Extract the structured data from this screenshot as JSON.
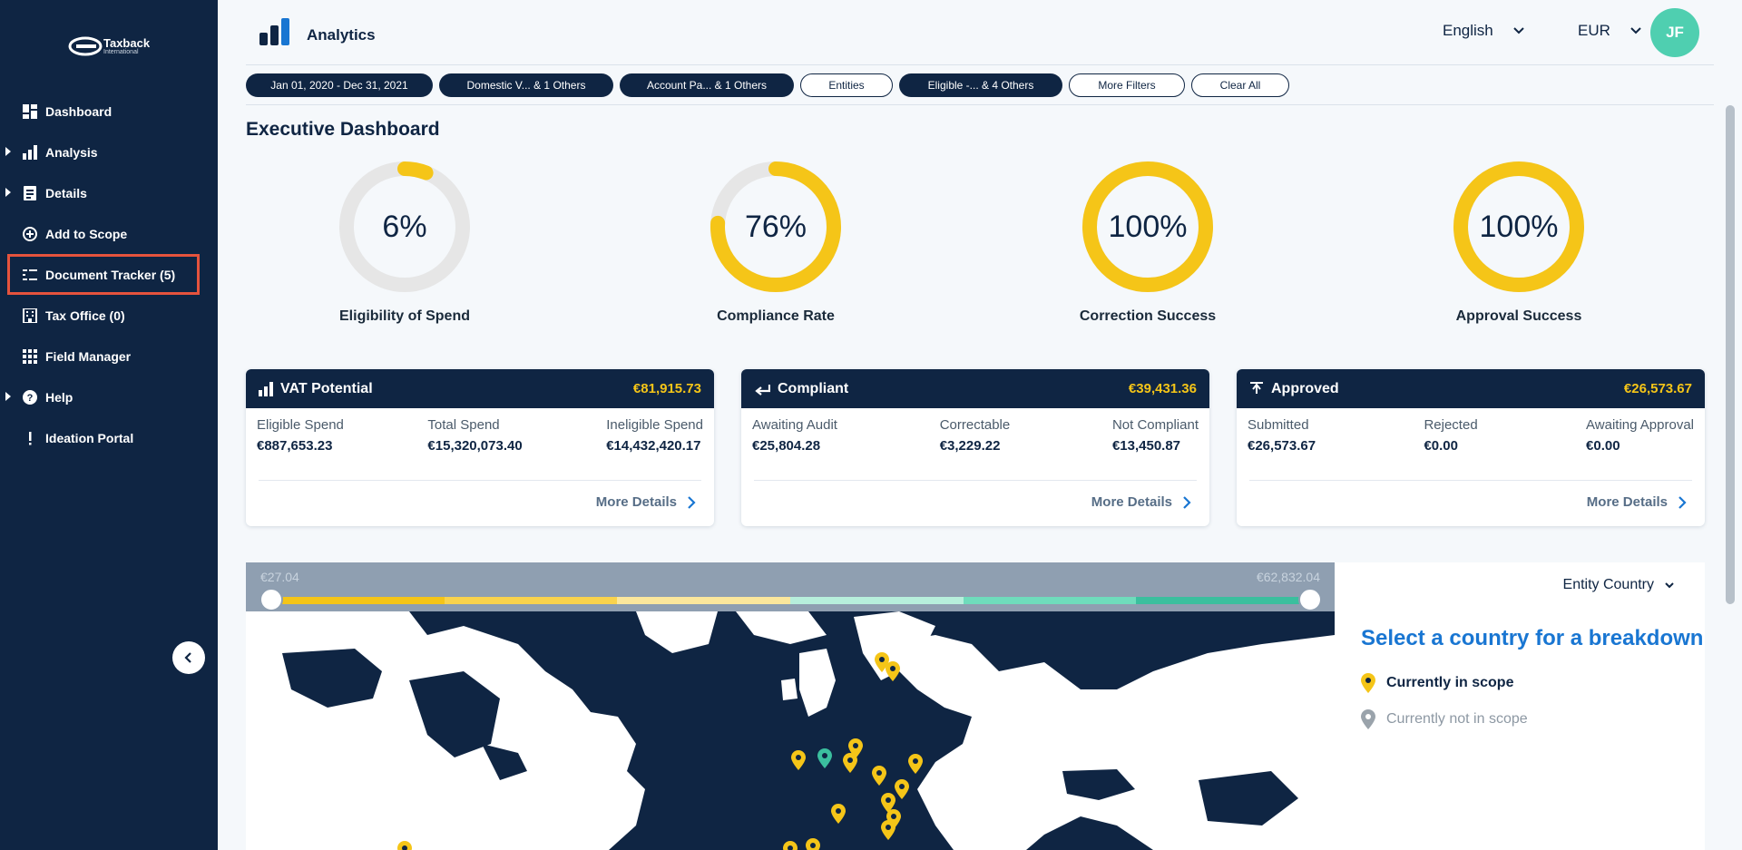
{
  "brand": {
    "name": "Taxback",
    "sub": "International"
  },
  "sidebar": {
    "items": [
      {
        "label": "Dashboard",
        "icon": "dashboard-icon",
        "caret": false
      },
      {
        "label": "Analysis",
        "icon": "bar-chart-icon",
        "caret": true
      },
      {
        "label": "Details",
        "icon": "document-list-icon",
        "caret": true
      },
      {
        "label": "Add to Scope",
        "icon": "plus-circle-icon",
        "caret": false
      },
      {
        "label": "Document Tracker (5)",
        "icon": "tracker-icon",
        "caret": false,
        "highlighted": true
      },
      {
        "label": "Tax Office (0)",
        "icon": "building-icon",
        "caret": false
      },
      {
        "label": "Field Manager",
        "icon": "grid-icon",
        "caret": false
      },
      {
        "label": "Help",
        "icon": "help-icon",
        "caret": true
      },
      {
        "label": "Ideation Portal",
        "icon": "exclamation-icon",
        "caret": false
      }
    ]
  },
  "header": {
    "title": "Analytics",
    "language": "English",
    "currency": "EUR",
    "avatar_initials": "JF"
  },
  "filters": [
    {
      "label": "Jan 01, 2020 - Dec 31, 2021",
      "style": "dark"
    },
    {
      "label": "Domestic V... & 1 Others",
      "style": "dark"
    },
    {
      "label": "Account Pa... & 1 Others",
      "style": "dark"
    },
    {
      "label": "Entities",
      "style": "light"
    },
    {
      "label": "Eligible -... & 4 Others",
      "style": "dark"
    },
    {
      "label": "More Filters",
      "style": "light"
    },
    {
      "label": "Clear All",
      "style": "light"
    }
  ],
  "page_title": "Executive Dashboard",
  "gauges": [
    {
      "value_text": "6%",
      "fraction": 0.06,
      "label": "Eligibility of Spend"
    },
    {
      "value_text": "76%",
      "fraction": 0.76,
      "label": "Compliance Rate"
    },
    {
      "value_text": "100%",
      "fraction": 1.0,
      "label": "Correction Success"
    },
    {
      "value_text": "100%",
      "fraction": 1.0,
      "label": "Approval Success"
    }
  ],
  "cards": [
    {
      "title": "VAT Potential",
      "amount": "€81,915.73",
      "icon": "bar-chart-icon",
      "cols": [
        {
          "label": "Eligible Spend",
          "value": "€887,653.23"
        },
        {
          "label": "Total Spend",
          "value": "€15,320,073.40"
        },
        {
          "label": "Ineligible Spend",
          "value": "€14,432,420.17"
        }
      ],
      "more": "More Details"
    },
    {
      "title": "Compliant",
      "amount": "€39,431.36",
      "icon": "return-arrow-icon",
      "cols": [
        {
          "label": "Awaiting Audit",
          "value": "€25,804.28"
        },
        {
          "label": "Correctable",
          "value": "€3,229.22"
        },
        {
          "label": "Not Compliant",
          "value": "€13,450.87"
        }
      ],
      "more": "More Details"
    },
    {
      "title": "Approved",
      "amount": "€26,573.67",
      "icon": "upload-icon",
      "cols": [
        {
          "label": "Submitted",
          "value": "€26,573.67"
        },
        {
          "label": "Rejected",
          "value": "€0.00"
        },
        {
          "label": "Awaiting Approval",
          "value": "€0.00"
        }
      ],
      "more": "More Details"
    }
  ],
  "map": {
    "range_min": "€27.04",
    "range_max": "€62,832.04",
    "dropdown": "Entity Country",
    "heading": "Select a country for a breakdown",
    "legend_in": "Currently in scope",
    "legend_out": "Currently not in scope",
    "colors": {
      "in_scope": "#f5c518",
      "not_in_scope": "#9aa3ab",
      "highlight": "#3bbf9e",
      "land": "#ffffff",
      "sea": "#0f2543"
    }
  }
}
